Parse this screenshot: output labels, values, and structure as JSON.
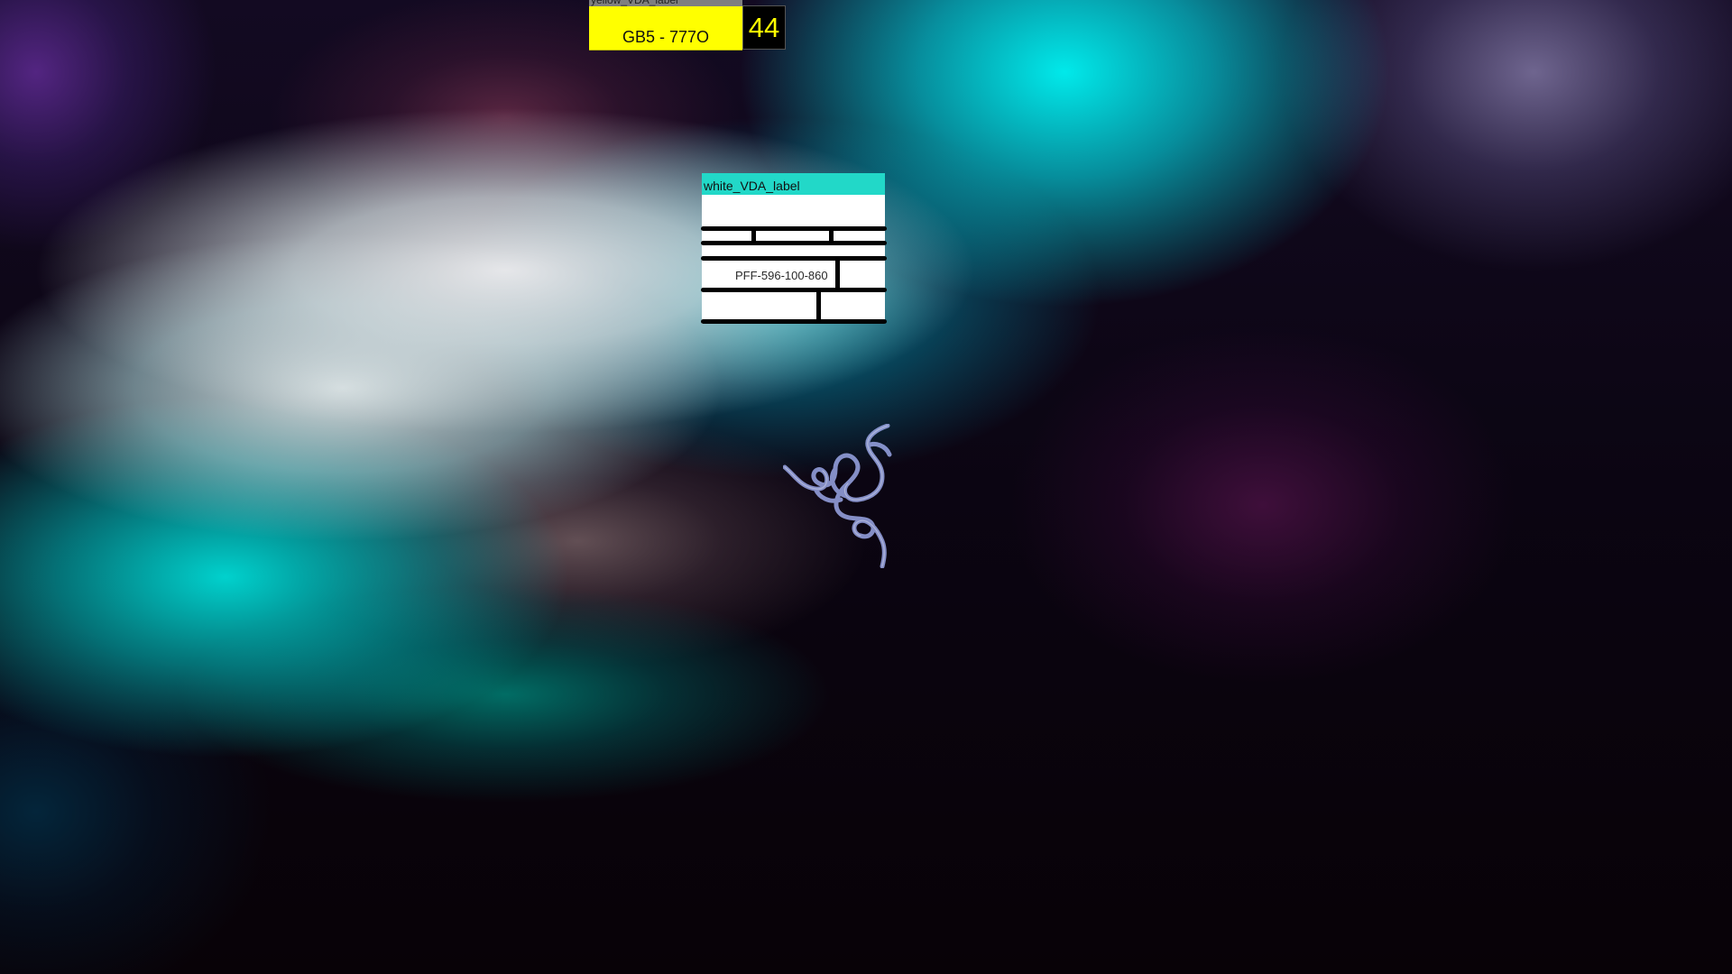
{
  "desktop": {
    "wallpaper": "abstract aurora gradient",
    "colors": {
      "cyan": "#00f0f0",
      "teal": "#00c8c0",
      "purple": "#5a2a8c",
      "dark": "#0a0308"
    }
  },
  "yellow_label": {
    "title": "yellow_VDA_label",
    "text": "GB5 - 777O",
    "count": "44",
    "background": "#ffff00",
    "count_color": "#ffff00"
  },
  "white_label": {
    "title": "white_VDA_label",
    "text": "PFF-596-100-860",
    "title_background": "#22d8c8"
  },
  "logo": {
    "icon": "razer-snake-logo-icon",
    "stroke_color": "#9aa6e6"
  }
}
